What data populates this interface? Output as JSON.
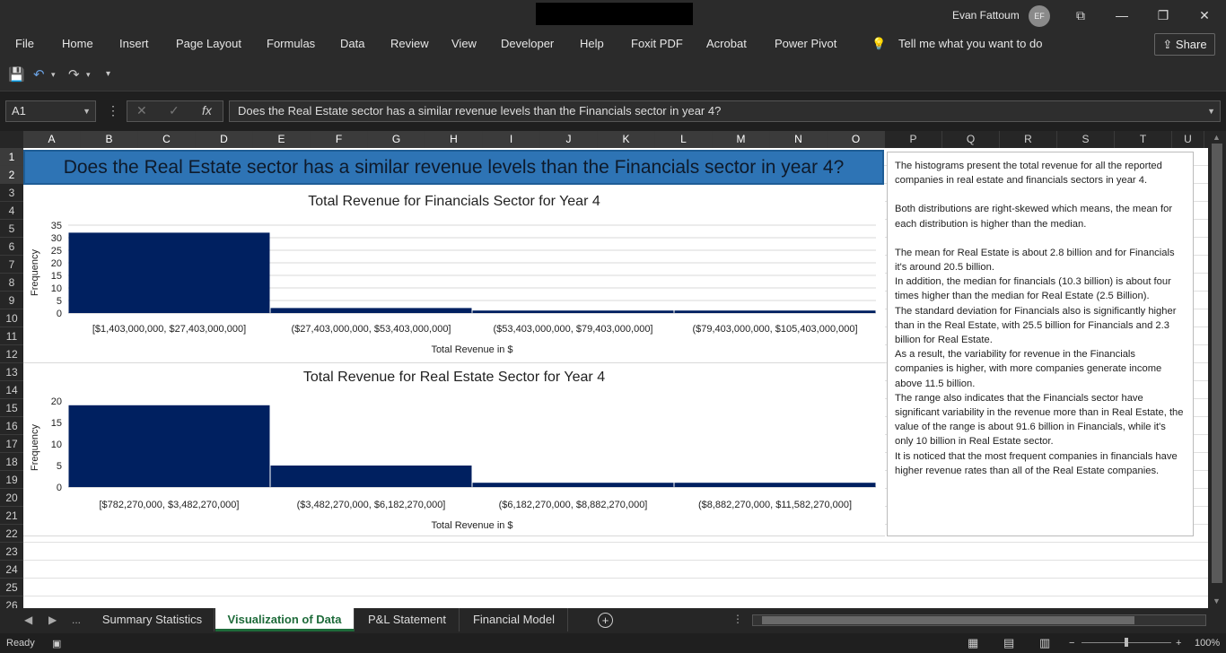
{
  "titlebar": {
    "user": "Evan Fattoum",
    "initials": "EF"
  },
  "menu": [
    "File",
    "Home",
    "Insert",
    "Page Layout",
    "Formulas",
    "Data",
    "Review",
    "View",
    "Developer",
    "Help",
    "Foxit PDF",
    "Acrobat",
    "Power Pivot"
  ],
  "tell_me": "Tell me what you want to do",
  "share_label": "Share",
  "namebox": "A1",
  "fx": "fx",
  "formula": "Does the Real Estate sector has a similar revenue levels than the Financials sector in year 4?",
  "columns": [
    "A",
    "B",
    "C",
    "D",
    "E",
    "F",
    "G",
    "H",
    "I",
    "J",
    "K",
    "L",
    "M",
    "N",
    "O",
    "P",
    "Q",
    "R",
    "S",
    "T",
    "U"
  ],
  "rows": [
    "1",
    "2",
    "3",
    "4",
    "5",
    "6",
    "7",
    "8",
    "9",
    "10",
    "11",
    "12",
    "13",
    "14",
    "15",
    "16",
    "17",
    "18",
    "19",
    "20",
    "21",
    "22",
    "23",
    "24",
    "25",
    "26"
  ],
  "title_cell": "Does the Real Estate sector has a similar revenue levels than the Financials sector in year 4?",
  "chart_data": [
    {
      "type": "bar",
      "title": "Total Revenue for Financials Sector for Year 4",
      "xlabel": "Total Revenue in $",
      "ylabel": "Frequency",
      "categories": [
        "[$1,403,000,000, $27,403,000,000]",
        "($27,403,000,000, $53,403,000,000]",
        "($53,403,000,000, $79,403,000,000]",
        "($79,403,000,000, $105,403,000,000]"
      ],
      "values": [
        32,
        2,
        1,
        1
      ],
      "ylim": [
        0,
        35
      ],
      "yticks": [
        0,
        5,
        10,
        15,
        20,
        25,
        30,
        35
      ],
      "grid": true,
      "color": "#002060"
    },
    {
      "type": "bar",
      "title": "Total Revenue for Real Estate Sector for Year 4",
      "xlabel": "Total Revenue in $",
      "ylabel": "Frequency",
      "categories": [
        "[$782,270,000, $3,482,270,000]",
        "($3,482,270,000, $6,182,270,000]",
        "($6,182,270,000, $8,882,270,000]",
        "($8,882,270,000, $11,582,270,000]"
      ],
      "values": [
        19,
        5,
        1,
        1
      ],
      "ylim": [
        0,
        20
      ],
      "yticks": [
        0,
        5,
        10,
        15,
        20
      ],
      "grid": false,
      "color": "#002060"
    }
  ],
  "notes": [
    "The histograms present the total revenue for all the reported companies in real estate and financials sectors in year 4.",
    "",
    "Both distributions are right-skewed which means, the mean for each distribution is higher than the median.",
    "",
    "The mean for Real Estate is about 2.8 billion and for Financials it's around 20.5 billion.",
    "In addition, the median for financials (10.3 billion) is about four times higher than the median for Real Estate (2.5 Billion).",
    "The standard deviation for Financials also is significantly higher than in the Real Estate, with 25.5 billion for Financials and 2.3 billion for Real Estate.",
    "As a result, the variability for revenue in the Financials companies is higher, with more companies generate income above 11.5 billion.",
    "The range also indicates that the Financials sector have significant variability in the revenue more than in Real Estate, the value of the range is about 91.6 billion in Financials, while it's only 10 billion in Real Estate sector.",
    "It is noticed that the most frequent companies in financials have higher revenue rates than all of the Real Estate companies."
  ],
  "tabs": [
    "Summary Statistics",
    "Visualization of Data",
    "P&L Statement",
    "Financial Model"
  ],
  "tabs_more": "...",
  "status": "Ready",
  "zoom": "100%"
}
